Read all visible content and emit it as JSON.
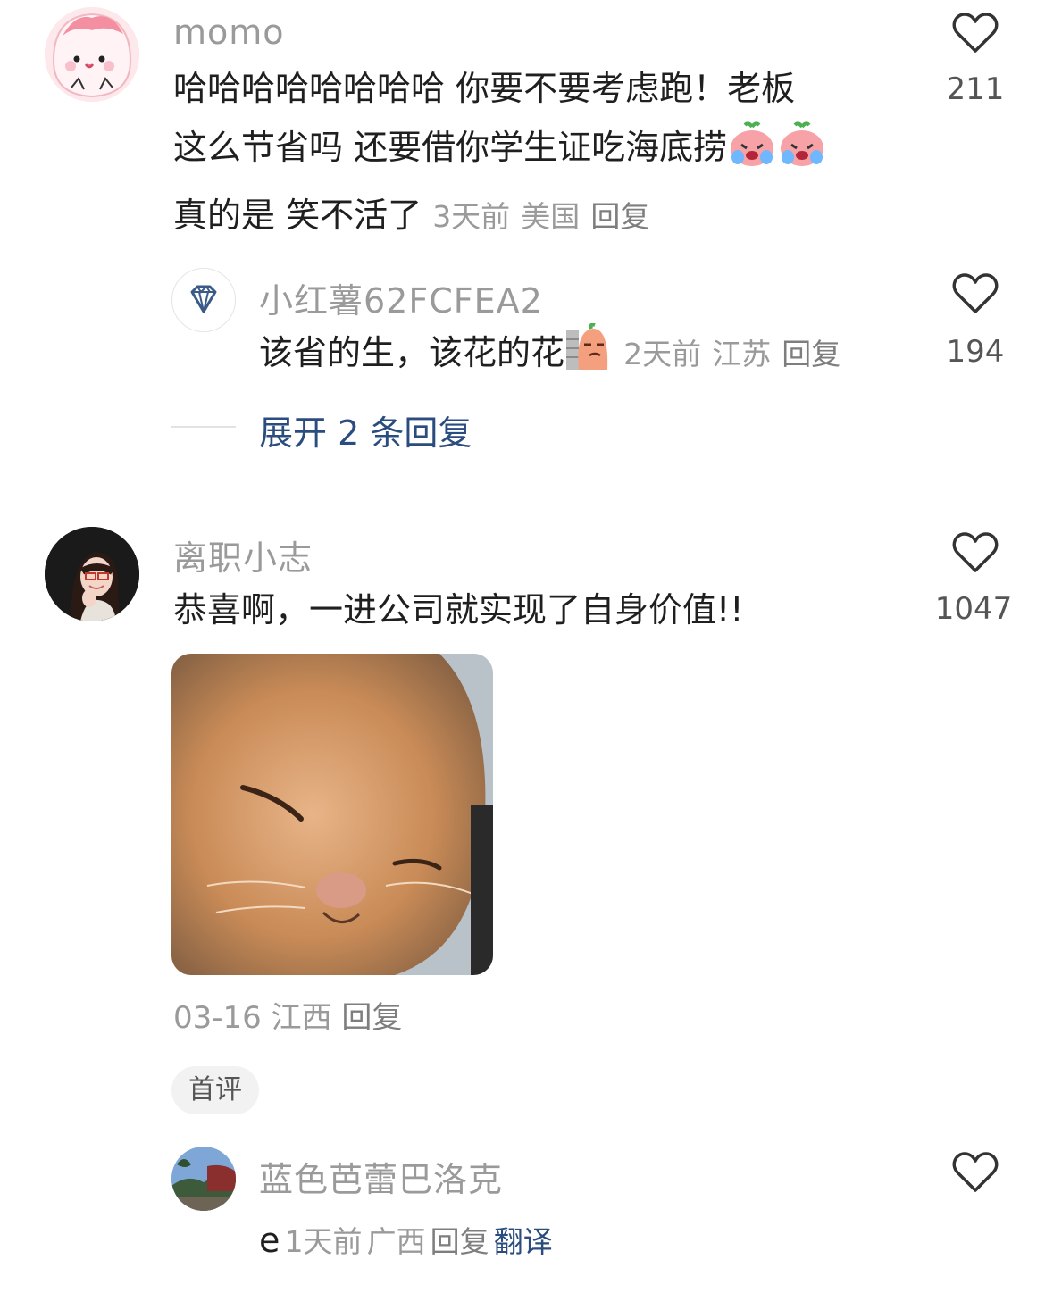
{
  "comments": [
    {
      "user": "momo",
      "text_line1": "哈哈哈哈哈哈哈哈 你要不要考虑跑！老板",
      "text_line2": "这么节省吗 还要借你学生证吃海底捞",
      "text_line3": "真的是 笑不活了",
      "time": "3天前",
      "location": "美国",
      "reply": "回复",
      "likes": "211",
      "icon": "crying-face-emoji"
    },
    {
      "user": "小红薯62FCFEA2",
      "text": "该省的生，该花的花",
      "time": "2天前",
      "location": "江苏",
      "reply": "回复",
      "likes": "194",
      "icon": "peeking-sausage-emoji"
    },
    {
      "user": "离职小志",
      "text": "恭喜啊，一进公司就实现了自身价值!!",
      "date": "03-16",
      "location": "江西",
      "reply": "回复",
      "likes": "1047",
      "tag": "首评",
      "image": "smiling-cat-photo"
    },
    {
      "user": "蓝色芭蕾巴洛克",
      "text": "e",
      "time": "1天前",
      "location": "广西",
      "reply": "回复",
      "translate": "翻译",
      "likes": ""
    }
  ],
  "expand_replies": "展开 2 条回复",
  "colors": {
    "link": "#2b4c7e",
    "meta": "#9a9a9a",
    "text": "#1f1f1f"
  }
}
